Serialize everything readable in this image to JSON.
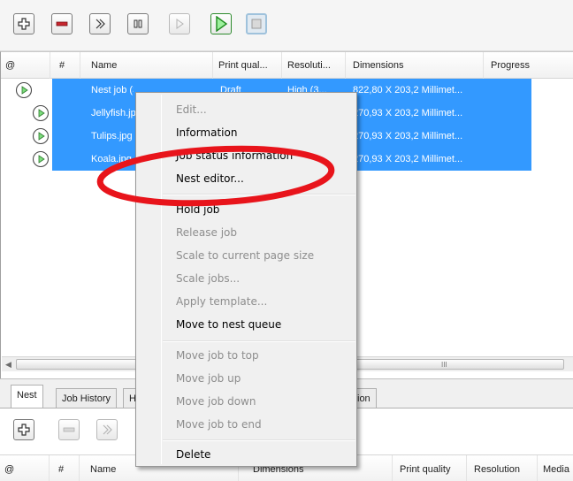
{
  "toolbar": {
    "icons": [
      "add-icon",
      "remove-icon",
      "skip-icon",
      "pause-icon",
      "play-disabled-icon",
      "play-green-icon",
      "stop-icon"
    ]
  },
  "list": {
    "columns": [
      "@",
      "#",
      "Name",
      "Print qual...",
      "Resoluti...",
      "Dimensions",
      "Progress"
    ],
    "rows": [
      {
        "name": "Nest job (3)",
        "print_quality": "Draft",
        "resolution": "High (3...",
        "dimensions": "822,80 X 203,2 Millimet..."
      },
      {
        "name": "Jellyfish.jp",
        "print_quality": "",
        "resolution": "",
        "dimensions": "270,93 X 203,2 Millimet..."
      },
      {
        "name": "Tulips.jpg",
        "print_quality": "",
        "resolution": "",
        "dimensions": "270,93 X 203,2 Millimet..."
      },
      {
        "name": "Koala.jpg",
        "print_quality": "",
        "resolution": "",
        "dimensions": "270,93 X 203,2 Millimet..."
      }
    ],
    "scroll_grip": "III"
  },
  "bottom": {
    "tabs": [
      "Nest",
      "Job History",
      "H",
      "ion"
    ],
    "columns": [
      "@",
      "#",
      "Name",
      "Dimensions",
      "Print quality",
      "Resolution",
      "Media"
    ]
  },
  "menu": {
    "items": [
      {
        "label": "Edit...",
        "enabled": false
      },
      {
        "label": "Information",
        "enabled": true
      },
      {
        "label": "Job status information",
        "enabled": true
      },
      {
        "label": "Nest editor...",
        "enabled": true
      },
      {
        "label": "Hold job",
        "enabled": true
      },
      {
        "label": "Release job",
        "enabled": false
      },
      {
        "label": "Scale to current page size",
        "enabled": false
      },
      {
        "label": "Scale jobs...",
        "enabled": false
      },
      {
        "label": "Apply template...",
        "enabled": false
      },
      {
        "label": "Move to nest queue",
        "enabled": true
      },
      {
        "label": "Move job to top",
        "enabled": false
      },
      {
        "label": "Move job up",
        "enabled": false
      },
      {
        "label": "Move job down",
        "enabled": false
      },
      {
        "label": "Move job to end",
        "enabled": false
      },
      {
        "label": "Delete",
        "enabled": true
      }
    ]
  },
  "colors": {
    "selection": "#3399ff",
    "highlight_ellipse": "#e8141b",
    "play_green": "#3cb43c"
  }
}
